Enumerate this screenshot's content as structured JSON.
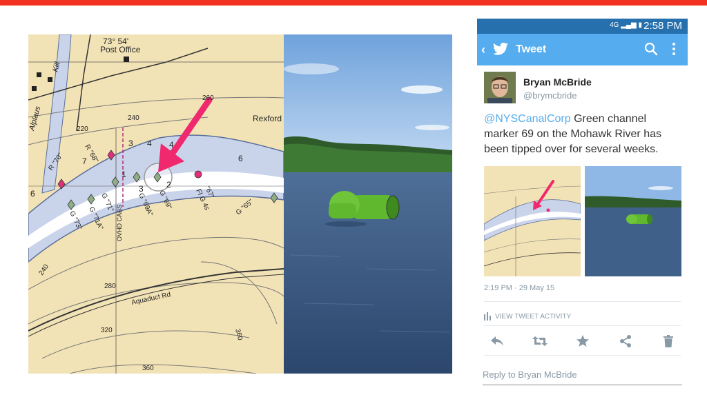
{
  "chart": {
    "coord": "73° 54'",
    "post_office": "Post Office",
    "place": "Rexford",
    "creek": "Alplaus",
    "kill": "Kill",
    "road": "Aquaduct Rd",
    "cables": "OVHD CABS",
    "depth_labels": [
      "260",
      "240",
      "220",
      "240",
      "280",
      "320",
      "360",
      "360"
    ],
    "sounding_labels": [
      "3",
      "4",
      "4",
      "6",
      "7",
      "6",
      "3",
      "2",
      "1"
    ],
    "buoy_labels": [
      "R \"70\"",
      "R \"68\"",
      "G \"73\"",
      "G \"71A\"",
      "G \"71\"",
      "G \"69A\"",
      "G \"69\"",
      "\"67\"",
      "FI G 4s",
      "G \"65\""
    ]
  },
  "phone": {
    "status": {
      "network": "4G",
      "time": "2:58 PM"
    },
    "app_title": "Tweet",
    "author": {
      "name": "Bryan McBride",
      "handle": "@brymcbride"
    },
    "tweet": {
      "mention": "@NYSCanalCorp",
      "body": " Green channel marker 69 on the Mohawk River has been tipped over for several weeks."
    },
    "timestamp": "2:19 PM · 29 May 15",
    "activity": "VIEW TWEET ACTIVITY",
    "reply_placeholder": "Reply to Bryan McBride"
  },
  "colors": {
    "accent_red": "#f2311f",
    "twitter_blue": "#55acee",
    "status_blue": "#2670ad",
    "arrow_pink": "#f0286e",
    "chart_land": "#f2e3b6",
    "chart_water": "#c9d3ea"
  },
  "icons": [
    "back-icon",
    "twitter-bird-icon",
    "search-icon",
    "overflow-menu-icon",
    "bar-chart-icon",
    "reply-icon",
    "retweet-icon",
    "favorite-icon",
    "share-icon",
    "delete-icon"
  ]
}
